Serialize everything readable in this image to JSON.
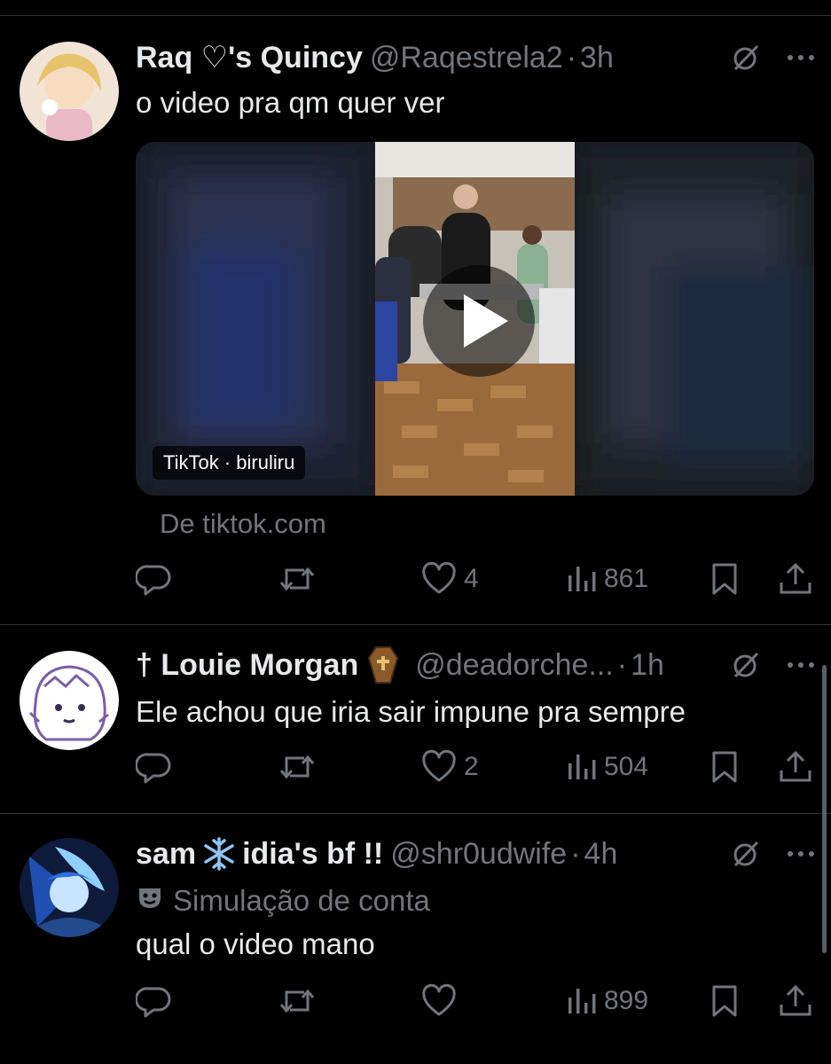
{
  "colors": {
    "background": "#000000",
    "text": "#e7e9ea",
    "muted": "#71767b",
    "divider": "#2f3336"
  },
  "posts": [
    {
      "name": "Raq ♡'s Quincy",
      "handle": "@Raqestrela2",
      "time": "3h",
      "text": "o video pra qm quer ver",
      "media_badge": "TikTok · biruliru",
      "source": "De tiktok.com",
      "reply_count": "",
      "retweet_count": "",
      "like_count": "4",
      "view_count": "861"
    },
    {
      "name": "† Louie Morgan",
      "handle": "@deadorche...",
      "time": "1h",
      "text": "Ele achou que iria sair impune pra sempre",
      "reply_count": "",
      "retweet_count": "",
      "like_count": "2",
      "view_count": "504"
    },
    {
      "name_prefix": "sam",
      "name_suffix": "idia's bf !!",
      "handle": "@shr0udwife",
      "time": "4h",
      "note": "Simulação de conta",
      "text": "qual o video mano",
      "reply_count": "",
      "retweet_count": "",
      "like_count": "",
      "view_count": "899"
    }
  ],
  "icons": {
    "reply": "reply-icon",
    "retweet": "retweet-icon",
    "like": "heart-icon",
    "views": "views-icon",
    "bookmark": "bookmark-icon",
    "share": "share-icon",
    "grok": "grok-icon",
    "more": "more-icon",
    "play": "play-icon"
  }
}
